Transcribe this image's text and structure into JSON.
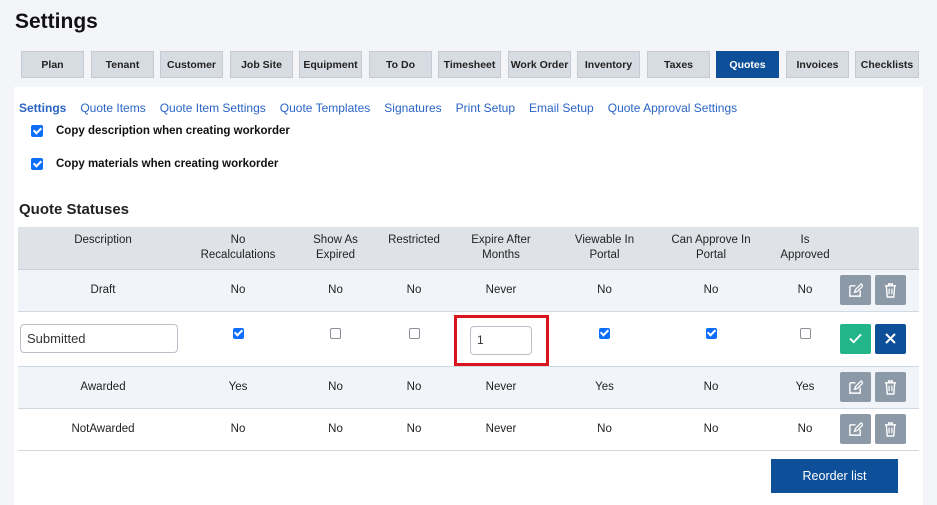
{
  "page": {
    "title": "Settings"
  },
  "top_tabs": [
    {
      "label": "Plan"
    },
    {
      "label": "Tenant"
    },
    {
      "label": "Customer"
    },
    {
      "label": "Job Site"
    },
    {
      "label": "Equipment"
    },
    {
      "label": "To Do"
    },
    {
      "label": "Timesheet"
    },
    {
      "label": "Work Order"
    },
    {
      "label": "Inventory"
    },
    {
      "label": "Taxes"
    },
    {
      "label": "Quotes",
      "active": true
    },
    {
      "label": "Invoices"
    },
    {
      "label": "Checklists"
    }
  ],
  "sub_tabs": [
    {
      "label": "Settings",
      "active": true
    },
    {
      "label": "Quote Items"
    },
    {
      "label": "Quote Item Settings"
    },
    {
      "label": "Quote Templates"
    },
    {
      "label": "Signatures"
    },
    {
      "label": "Print Setup"
    },
    {
      "label": "Email Setup"
    },
    {
      "label": "Quote Approval Settings"
    }
  ],
  "options": {
    "copy_description": {
      "label": "Copy description when creating workorder",
      "checked": true
    },
    "copy_materials": {
      "label": "Copy materials when creating workorder",
      "checked": true
    }
  },
  "statuses": {
    "title": "Quote Statuses",
    "headers": {
      "description": "Description",
      "no_recalc": [
        "No",
        "Recalculations"
      ],
      "show_expired": [
        "Show As",
        "Expired"
      ],
      "restricted": "Restricted",
      "expire_after": [
        "Expire After",
        "Months"
      ],
      "viewable": [
        "Viewable In",
        "Portal"
      ],
      "can_approve": [
        "Can Approve In",
        "Portal"
      ],
      "is_approved": [
        "Is",
        "Approved"
      ]
    },
    "rows": [
      {
        "description": "Draft",
        "no_recalc": "No",
        "show_expired": "No",
        "restricted": "No",
        "expire_after": "Never",
        "viewable": "No",
        "can_approve": "No",
        "is_approved": "No"
      },
      {
        "description": "Submitted",
        "editing": true,
        "no_recalc": true,
        "show_expired": false,
        "restricted": false,
        "expire_after": "1",
        "viewable": true,
        "can_approve": true,
        "is_approved": false
      },
      {
        "description": "Awarded",
        "no_recalc": "Yes",
        "show_expired": "No",
        "restricted": "No",
        "expire_after": "Never",
        "viewable": "Yes",
        "can_approve": "No",
        "is_approved": "Yes"
      },
      {
        "description": "NotAwarded",
        "no_recalc": "No",
        "show_expired": "No",
        "restricted": "No",
        "expire_after": "Never",
        "viewable": "No",
        "can_approve": "No",
        "is_approved": "No"
      }
    ]
  },
  "buttons": {
    "reorder_label": "Reorder list"
  },
  "colors": {
    "primary": "#0d4f99",
    "success": "#23b58a",
    "muted_button": "#8c99a6",
    "link": "#2a64c5",
    "highlight": "#d9141c"
  },
  "icons": {
    "edit": "edit-icon",
    "delete": "trash-icon",
    "confirm": "check-icon",
    "cancel": "close-icon"
  }
}
